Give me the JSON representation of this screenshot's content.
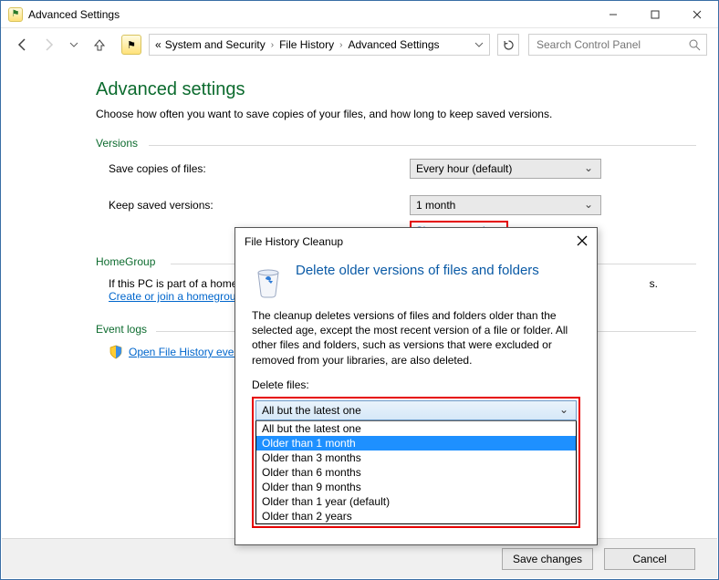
{
  "window": {
    "title": "Advanced Settings"
  },
  "nav": {
    "chev": "«",
    "crumb1": "System and Security",
    "crumb2": "File History",
    "crumb3": "Advanced Settings",
    "search_placeholder": "Search Control Panel"
  },
  "page": {
    "title": "Advanced settings",
    "subtitle": "Choose how often you want to save copies of your files, and how long to keep saved versions."
  },
  "groups": {
    "versions": "Versions",
    "homegroup": "HomeGroup",
    "eventlogs": "Event logs"
  },
  "form": {
    "save_label": "Save copies of files:",
    "save_value": "Every hour (default)",
    "keep_label": "Keep saved versions:",
    "keep_value": "1 month",
    "cleanup_link": "Clean up versions"
  },
  "homegroup": {
    "line": "If this PC is part of a homeg",
    "trailing": "s.",
    "link": "Create or join a homegrou"
  },
  "eventlogs": {
    "link": "Open File History event"
  },
  "footer": {
    "save": "Save changes",
    "cancel": "Cancel"
  },
  "dialog": {
    "title": "File History Cleanup",
    "heading": "Delete older versions of files and folders",
    "body": "The cleanup deletes versions of files and folders older than the selected age, except the most recent version of a file or folder. All other files and folders, such as versions that were excluded or removed from your libraries, are also deleted.",
    "delete_label": "Delete files:",
    "selected": "All but the latest one",
    "options": [
      "All but the latest one",
      "Older than 1 month",
      "Older than 3 months",
      "Older than 6 months",
      "Older than 9 months",
      "Older than 1 year (default)",
      "Older than 2 years"
    ],
    "highlight_index": 1
  }
}
